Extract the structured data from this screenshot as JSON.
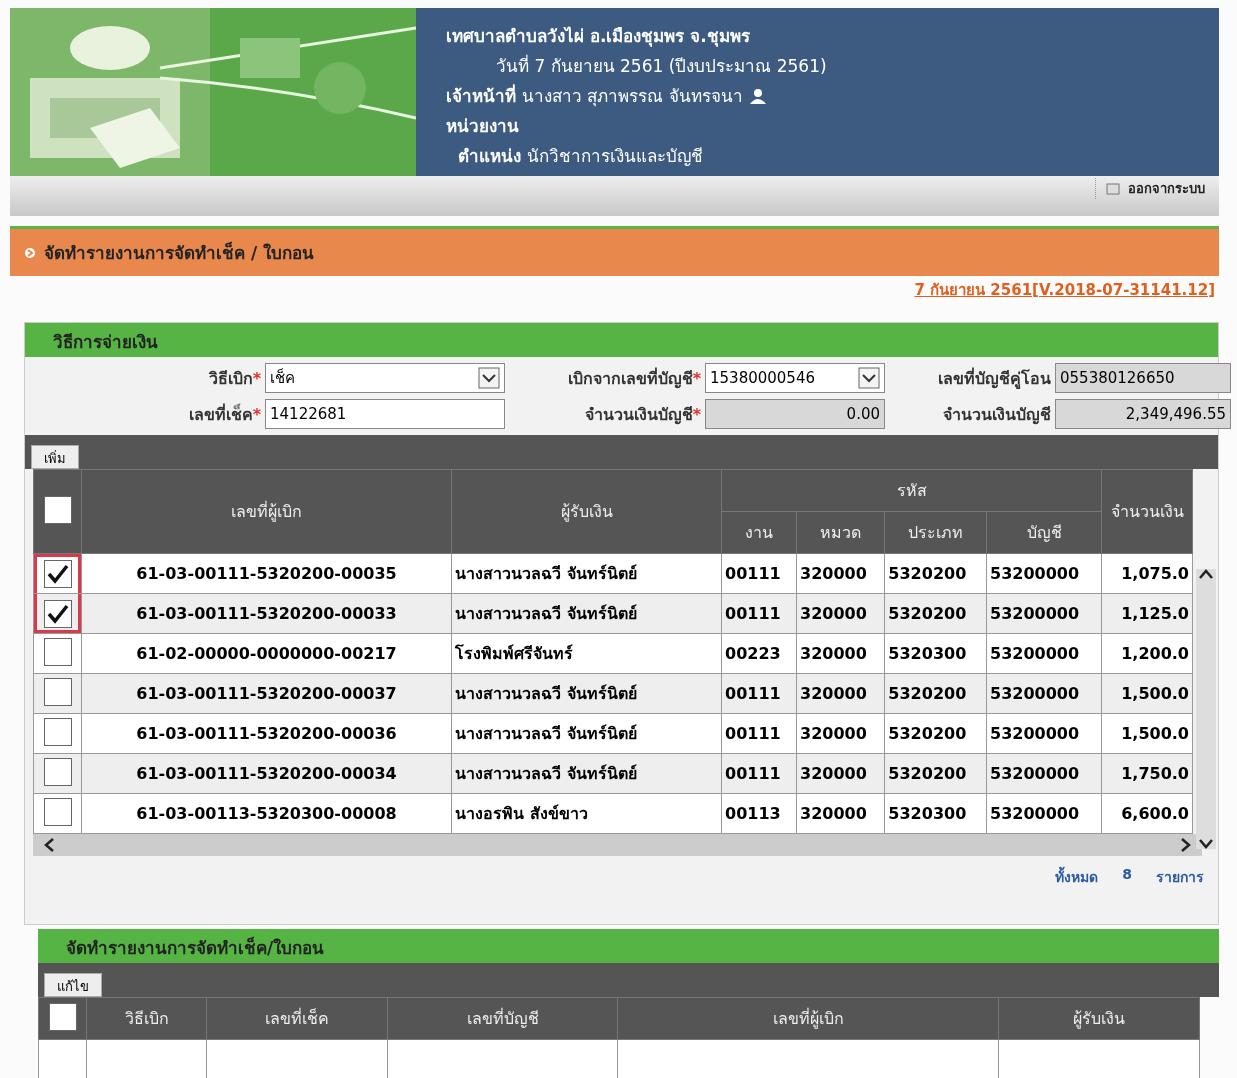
{
  "header": {
    "org": "เทศบาลตำบลวังไผ่ อ.เมืองชุมพร จ.ชุมพร",
    "date": "วันที่ 7 กันยายน 2561  (ปีงบประมาณ 2561)",
    "officer_label": "เจ้าหน้าที่",
    "officer": "นางสาว สุภาพรรณ จันทรจนา",
    "unit_label": "หน่วยงาน",
    "position_label": "ตำแหน่ง",
    "position": "นักวิชาการเงินและบัญชี",
    "logout": "ออกจากระบบ"
  },
  "page_title": "จัดทำรายงานการจัดทำเช็ค / ใบกอน",
  "version": "7 กันยายน 2561[V.2018-07-31141.12]",
  "payment": {
    "title": "วิธีการจ่ายเงิน",
    "fields": [
      {
        "label": "วิธีเบิก",
        "required_mark": "*",
        "kind": "select",
        "value": "เช็ค"
      },
      {
        "label": "เบิกจากเลขที่บัญชี",
        "required_mark": "*",
        "kind": "select",
        "value": "15380000546"
      },
      {
        "label": "เลขที่บัญชีคู่โอน",
        "kind": "readonly",
        "value": "055380126650"
      },
      {
        "label": "เลขที่เช็ค",
        "required_mark": "*",
        "kind": "text",
        "value": "14122681"
      },
      {
        "label": "จำนวนเงินบัญชี",
        "required_mark": "*",
        "kind": "readonly",
        "value": "0.00"
      },
      {
        "label": "จำนวนเงินบัญชี",
        "kind": "readonly",
        "value": "2,349,496.55"
      }
    ]
  },
  "add_button": "เพิ่ม",
  "table": {
    "select_all": false,
    "columns": {
      "withdrawal_no": "เลขที่ผู้เบิก",
      "payee": "ผู้รับเงิน",
      "code": "รหัส",
      "code_parts": [
        "งาน",
        "หมวด",
        "ประเภท",
        "บัญชี"
      ],
      "amount": "จำนวนเงิน"
    },
    "rows": [
      {
        "checked": true,
        "highlighted": true,
        "withdrawal_no": "61-03-00111-5320200-00035",
        "payee": "นางสาวนวลฉวี จันทร์นิตย์",
        "codes": [
          "00111",
          "320000",
          "5320200",
          "53200000"
        ],
        "amount": "1,075.0"
      },
      {
        "checked": true,
        "highlighted": true,
        "withdrawal_no": "61-03-00111-5320200-00033",
        "payee": "นางสาวนวลฉวี จันทร์นิตย์",
        "codes": [
          "00111",
          "320000",
          "5320200",
          "53200000"
        ],
        "amount": "1,125.0"
      },
      {
        "checked": false,
        "highlighted": false,
        "withdrawal_no": "61-02-00000-0000000-00217",
        "payee": "โรงพิมพ์ศรีจันทร์",
        "codes": [
          "00223",
          "320000",
          "5320300",
          "53200000"
        ],
        "amount": "1,200.0"
      },
      {
        "checked": false,
        "highlighted": false,
        "withdrawal_no": "61-03-00111-5320200-00037",
        "payee": "นางสาวนวลฉวี จันทร์นิตย์",
        "codes": [
          "00111",
          "320000",
          "5320200",
          "53200000"
        ],
        "amount": "1,500.0"
      },
      {
        "checked": false,
        "highlighted": false,
        "withdrawal_no": "61-03-00111-5320200-00036",
        "payee": "นางสาวนวลฉวี จันทร์นิตย์",
        "codes": [
          "00111",
          "320000",
          "5320200",
          "53200000"
        ],
        "amount": "1,500.0"
      },
      {
        "checked": false,
        "highlighted": false,
        "withdrawal_no": "61-03-00111-5320200-00034",
        "payee": "นางสาวนวลฉวี จันทร์นิตย์",
        "codes": [
          "00111",
          "320000",
          "5320200",
          "53200000"
        ],
        "amount": "1,750.0"
      },
      {
        "checked": false,
        "highlighted": false,
        "withdrawal_no": "61-03-00113-5320300-00008",
        "payee": "นางอรพิน สังข์ขาว",
        "codes": [
          "00113",
          "320000",
          "5320300",
          "53200000"
        ],
        "amount": "6,600.0"
      }
    ]
  },
  "total": {
    "label": "ทั้งหมด",
    "count": "8",
    "unit": "รายการ"
  },
  "report": {
    "title": "จัดทำรายงานการจัดทำเช็ค/ใบกอน",
    "edit_button": "แก้ไข",
    "select_all": false,
    "columns": [
      "วิธีเบิก",
      "เลขที่เช็ค",
      "เลขที่บัญชี",
      "เลขที่ผู้เบิก",
      "ผู้รับเงิน"
    ]
  }
}
